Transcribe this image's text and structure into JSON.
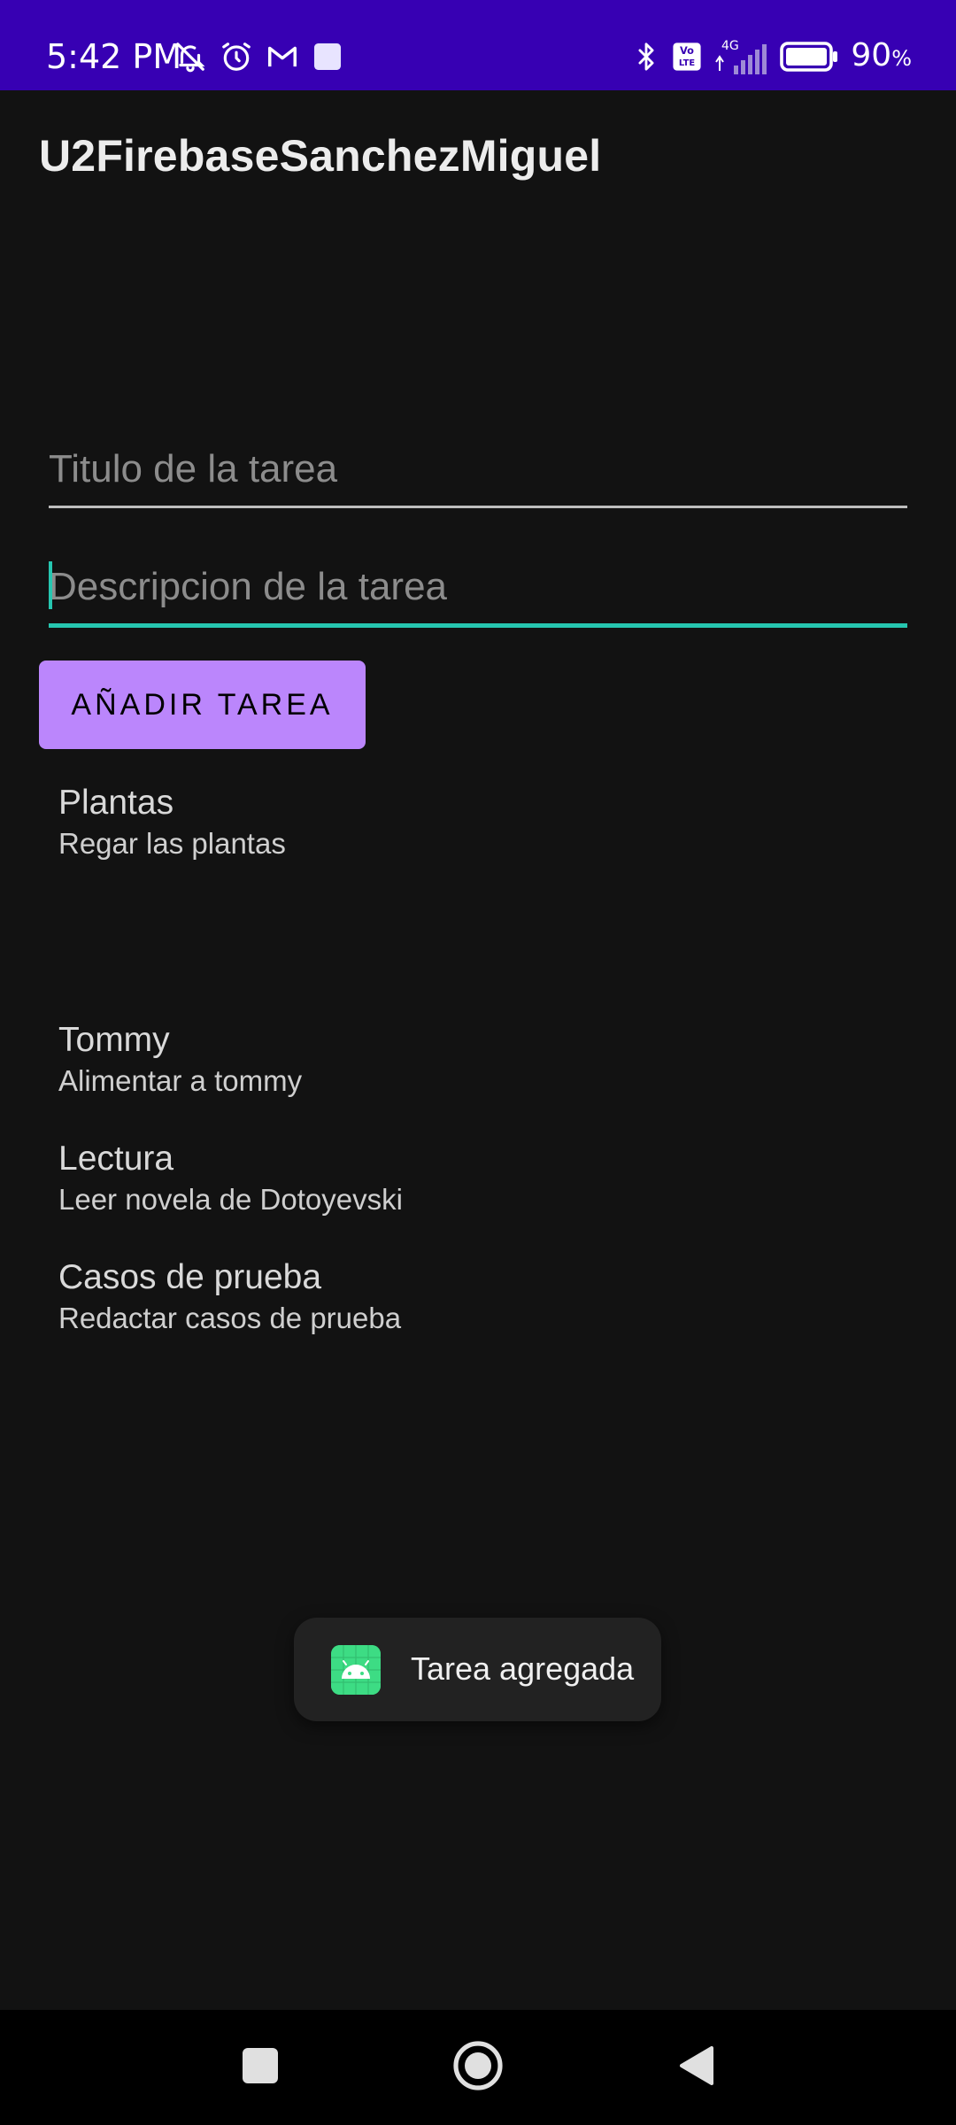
{
  "status_bar": {
    "time": "5:42 PM",
    "network": "4G",
    "volte": "Vo LTE",
    "battery_percent": "90",
    "battery_unit": "%",
    "left_icons": [
      "bell-off-icon",
      "alarm-icon",
      "gmail-icon",
      "app-square-icon"
    ],
    "right_icons": [
      "bluetooth-icon",
      "volte-icon",
      "signal-icon",
      "battery-icon"
    ]
  },
  "app_bar": {
    "title": "U2FirebaseSanchezMiguel"
  },
  "form": {
    "title_input": {
      "value": "",
      "placeholder": "Titulo de la tarea"
    },
    "description_input": {
      "value": "",
      "placeholder": "Descripcion de la tarea"
    },
    "add_button_label": "AÑADIR TAREA"
  },
  "tasks": [
    {
      "title": "Plantas",
      "description": "Regar las plantas"
    },
    {
      "title": "Tommy",
      "description": "Alimentar a tommy"
    },
    {
      "title": "Lectura",
      "description": "Leer novela de Dotoyevski"
    },
    {
      "title": "Casos de prueba",
      "description": "Redactar casos de prueba"
    }
  ],
  "toast": {
    "message": "Tarea agregada",
    "icon": "android-icon"
  },
  "nav_bar": {
    "buttons": [
      "recents-icon",
      "home-icon",
      "back-icon"
    ]
  },
  "colors": {
    "status_bar": "#3700b3",
    "background": "#121212",
    "accent_teal": "#26c6b0",
    "button_purple": "#bb86fc",
    "android_green": "#3ddc84"
  }
}
